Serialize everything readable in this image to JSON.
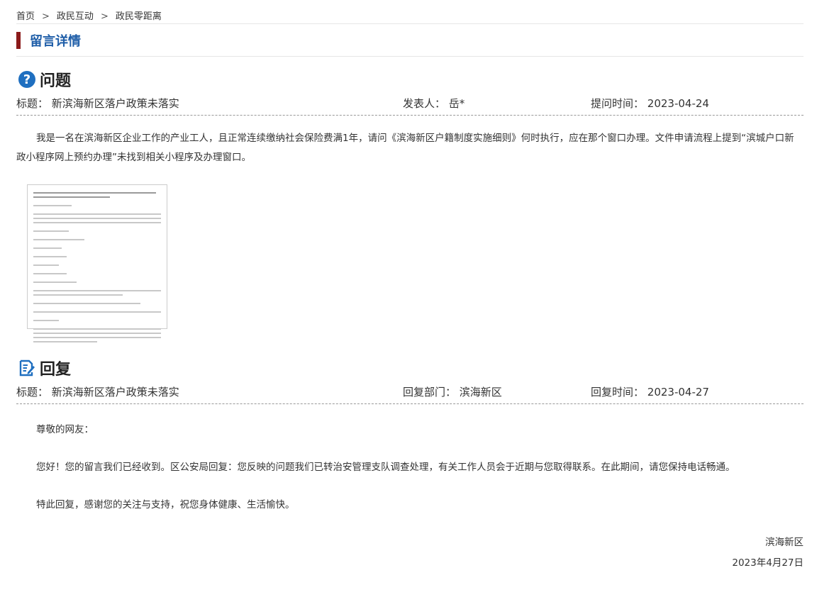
{
  "breadcrumb": {
    "home": "首页",
    "sep": ">",
    "level1": "政民互动",
    "level2": "政民零距离"
  },
  "section_title": "留言详情",
  "question": {
    "heading": "问题",
    "icon": "question-circle-icon",
    "title_label": "标题：",
    "title_value": "新滨海新区落户政策未落实",
    "author_label": "发表人：",
    "author_value": "岳*",
    "time_label": "提问时间：",
    "time_value": "2023-04-24",
    "body": "我是一名在滨海新区企业工作的产业工人，且正常连续缴纳社会保险费满1年，请问《滨海新区户籍制度实施细则》何时执行，应在那个窗口办理。文件申请流程上提到“滨城户口新政小程序网上预约办理”未找到相关小程序及办理窗口。",
    "attachment": "document-thumbnail"
  },
  "reply": {
    "heading": "回复",
    "icon": "edit-note-icon",
    "title_label": "标题：",
    "title_value": "新滨海新区落户政策未落实",
    "dept_label": "回复部门：",
    "dept_value": "滨海新区",
    "time_label": "回复时间：",
    "time_value": "2023-04-27",
    "greeting": "尊敬的网友：",
    "content": "您好！您的留言我们已经收到。区公安局回复：您反映的问题我们已转治安管理支队调查处理，有关工作人员会于近期与您取得联系。在此期间，请您保持电话畅通。",
    "closing": "特此回复，感谢您的关注与支持，祝您身体健康、生活愉快。",
    "signature": "滨海新区",
    "date": "2023年4月27日"
  },
  "colors": {
    "accent_bar": "#8b1a1a",
    "title_blue": "#1f5ea8",
    "icon_blue": "#1f6fc0"
  }
}
